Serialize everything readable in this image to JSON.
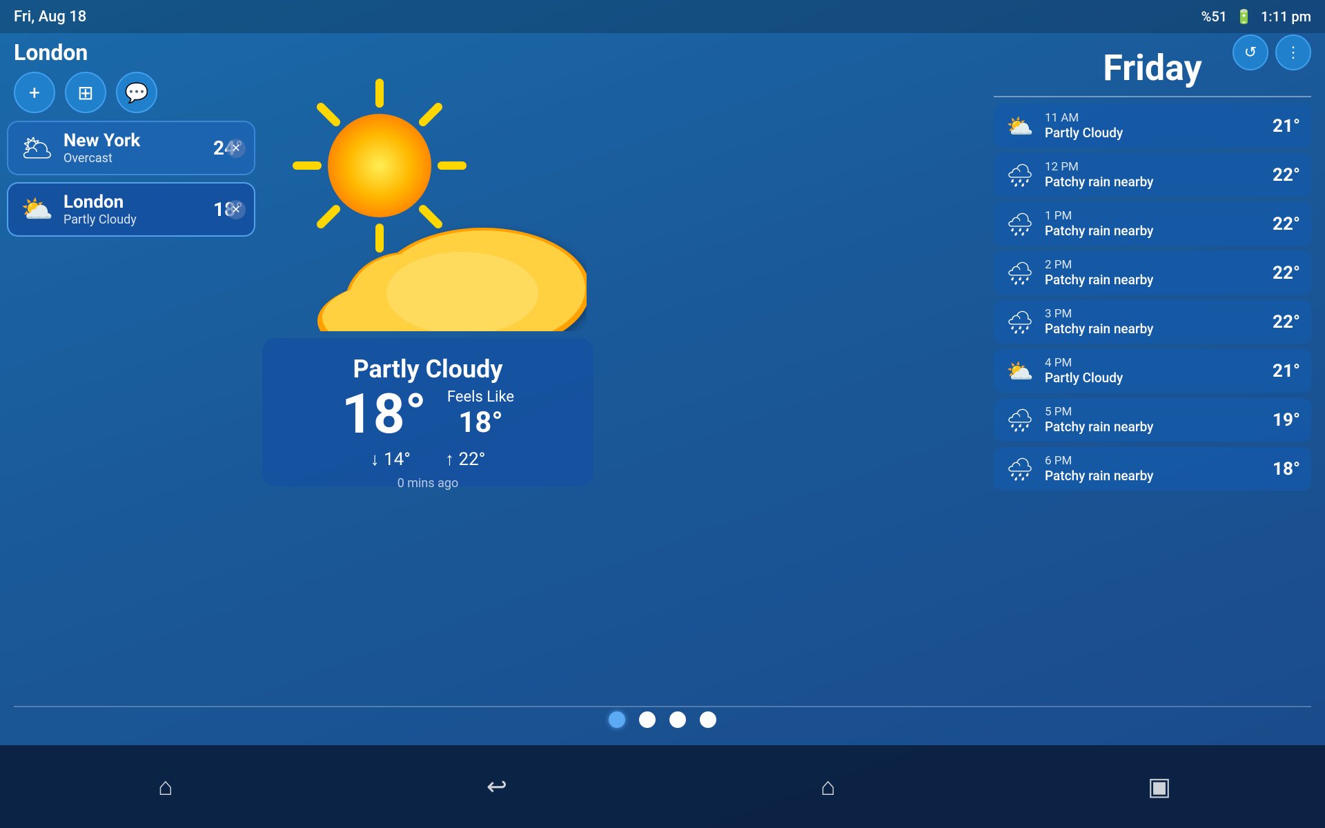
{
  "statusBar": {
    "datetime": "Fri, Aug 18",
    "battery": "%51",
    "time": "1:11 pm"
  },
  "appTitle": "London",
  "headerButtons": {
    "refresh": "↺",
    "menu": "⋮"
  },
  "toolbar": {
    "addBtn": "+",
    "widgetBtn": "⊞",
    "chatBtn": "💬"
  },
  "cities": [
    {
      "name": "New York",
      "temp": "24°",
      "condition": "Overcast",
      "icon": "🌥",
      "active": false
    },
    {
      "name": "London",
      "temp": "18°",
      "condition": "Partly Cloudy",
      "icon": "⛅",
      "active": true
    }
  ],
  "currentWeather": {
    "condition": "Partly Cloudy",
    "temp": "18°",
    "feelsLabel": "Feels Like",
    "feelsTemp": "18°",
    "low": "14°",
    "high": "22°",
    "updateTime": "0 mins ago"
  },
  "forecastDay": "Friday",
  "forecast": [
    {
      "time": "11 AM",
      "condition": "Partly Cloudy",
      "temp": "21°",
      "icon": "⛅"
    },
    {
      "time": "12 PM",
      "condition": "Patchy rain nearby",
      "temp": "22°",
      "icon": "🌧"
    },
    {
      "time": "1 PM",
      "condition": "Patchy rain nearby",
      "temp": "22°",
      "icon": "🌧"
    },
    {
      "time": "2 PM",
      "condition": "Patchy rain nearby",
      "temp": "22°",
      "icon": "🌧"
    },
    {
      "time": "3 PM",
      "condition": "Patchy rain nearby",
      "temp": "22°",
      "icon": "🌧"
    },
    {
      "time": "4 PM",
      "condition": "Partly Cloudy",
      "temp": "21°",
      "icon": "⛅"
    },
    {
      "time": "5 PM",
      "condition": "Patchy rain nearby",
      "temp": "19°",
      "icon": "🌧"
    },
    {
      "time": "6 PM",
      "condition": "Patchy rain nearby",
      "temp": "18°",
      "icon": "🌧"
    }
  ],
  "pageDots": [
    "active",
    "dot1",
    "dot2",
    "dot3"
  ],
  "bottomNav": {
    "home": "⌂",
    "back": "↩",
    "house": "⌂",
    "recent": "▣"
  }
}
